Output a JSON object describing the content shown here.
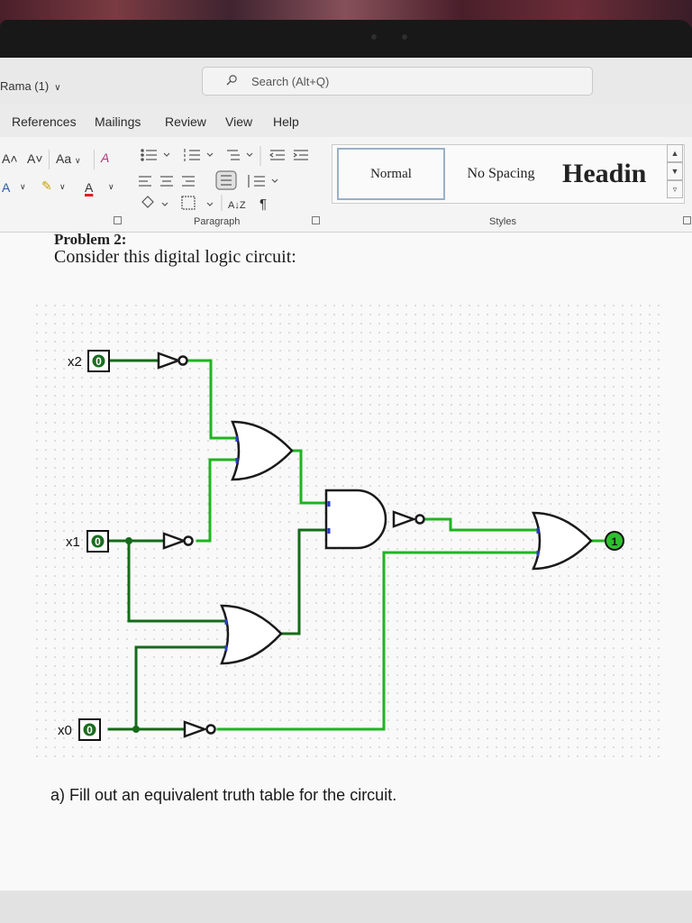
{
  "window": {
    "doc_name": "Rama (1)",
    "search_placeholder": "Search (Alt+Q)"
  },
  "menu": {
    "tabs": [
      "References",
      "Mailings",
      "Review",
      "View",
      "Help"
    ]
  },
  "ribbon": {
    "font_group": {
      "grow_font": "A˄",
      "shrink_font": "A˅",
      "change_case": "Aa",
      "clear_format": "A",
      "font_color": "A",
      "text_effects": "A"
    },
    "paragraph_label": "Paragraph",
    "styles_label": "Styles",
    "styles": [
      {
        "label": "Normal"
      },
      {
        "label": "No Spacing"
      },
      {
        "label": "Headin"
      }
    ],
    "sort_glyph": "A↓Z",
    "pilcrow": "¶"
  },
  "document": {
    "problem_heading": "Problem 2:",
    "intro": "Consider this digital logic circuit:",
    "question_a": "a) Fill out an equivalent truth table for the circuit."
  },
  "circuit": {
    "inputs": [
      {
        "label": "x2",
        "value": "0"
      },
      {
        "label": "x1",
        "value": "0"
      },
      {
        "label": "x0",
        "value": "0"
      }
    ],
    "output": {
      "value": "1"
    },
    "colors": {
      "active_wire": "#1fb421",
      "inactive_wire": "#156b1a",
      "gate": "#1a1a1a",
      "pin_mark": "#2a3cc0"
    }
  }
}
